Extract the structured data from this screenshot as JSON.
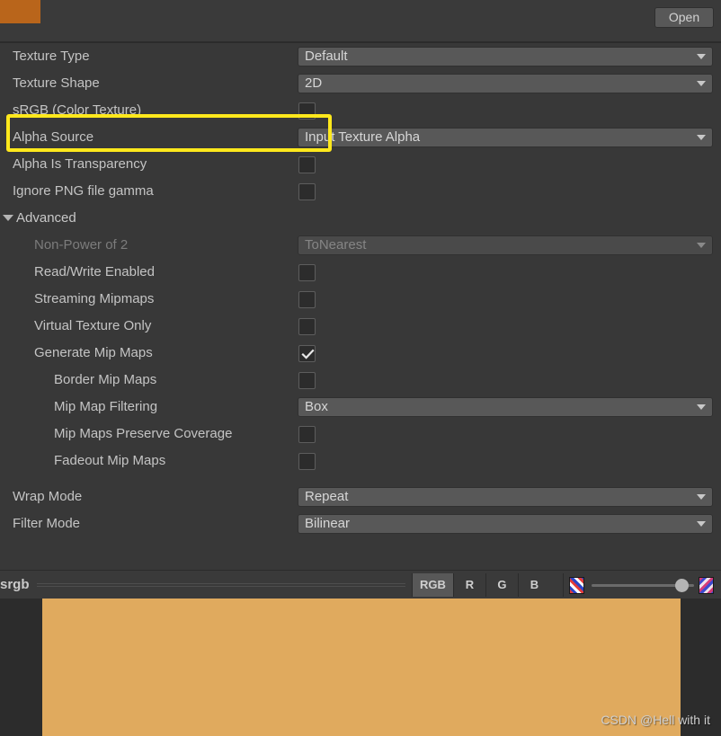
{
  "window": {
    "open_button": "Open",
    "tab_color": "#b9651b"
  },
  "inspector": {
    "rows": [
      {
        "label": "Texture Type",
        "control": "dropdown",
        "value": "Default",
        "indent": 0,
        "disabled": false
      },
      {
        "label": "Texture Shape",
        "control": "dropdown",
        "value": "2D",
        "indent": 0,
        "disabled": false
      },
      {
        "label": "sRGB (Color Texture)",
        "control": "checkbox",
        "checked": false,
        "indent": 0,
        "disabled": false,
        "highlighted": true
      },
      {
        "label": "Alpha Source",
        "control": "dropdown",
        "value": "Input Texture Alpha",
        "indent": 0,
        "disabled": false
      },
      {
        "label": "Alpha Is Transparency",
        "control": "checkbox",
        "checked": false,
        "indent": 0,
        "disabled": false
      },
      {
        "label": "Ignore PNG file gamma",
        "control": "checkbox",
        "checked": false,
        "indent": 0,
        "disabled": false
      }
    ],
    "advanced": {
      "label": "Advanced",
      "expanded": true,
      "rows": [
        {
          "label": "Non-Power of 2",
          "control": "dropdown",
          "value": "ToNearest",
          "indent": 1,
          "disabled": true
        },
        {
          "label": "Read/Write Enabled",
          "control": "checkbox",
          "checked": false,
          "indent": 1,
          "disabled": false
        },
        {
          "label": "Streaming Mipmaps",
          "control": "checkbox",
          "checked": false,
          "indent": 1,
          "disabled": false
        },
        {
          "label": "Virtual Texture Only",
          "control": "checkbox",
          "checked": false,
          "indent": 1,
          "disabled": false
        },
        {
          "label": "Generate Mip Maps",
          "control": "checkbox",
          "checked": true,
          "indent": 1,
          "disabled": false
        },
        {
          "label": "Border Mip Maps",
          "control": "checkbox",
          "checked": false,
          "indent": 2,
          "disabled": false
        },
        {
          "label": "Mip Map Filtering",
          "control": "dropdown",
          "value": "Box",
          "indent": 2,
          "disabled": false
        },
        {
          "label": "Mip Maps Preserve Coverage",
          "control": "checkbox",
          "checked": false,
          "indent": 2,
          "disabled": false
        },
        {
          "label": "Fadeout Mip Maps",
          "control": "checkbox",
          "checked": false,
          "indent": 2,
          "disabled": false
        }
      ]
    },
    "tail_rows": [
      {
        "label": "Wrap Mode",
        "control": "dropdown",
        "value": "Repeat",
        "indent": 0,
        "disabled": false
      },
      {
        "label": "Filter Mode",
        "control": "dropdown",
        "value": "Bilinear",
        "indent": 0,
        "disabled": false
      }
    ]
  },
  "preview": {
    "asset_name": "srgb",
    "channels": [
      {
        "label": "RGB",
        "active": true
      },
      {
        "label": "R",
        "active": false
      },
      {
        "label": "G",
        "active": false
      },
      {
        "label": "B",
        "active": false
      }
    ],
    "mip_level_percent": 84,
    "texture_color": "#e0aa5e",
    "watermark": "CSDN @Hell with it"
  },
  "highlight": {
    "color": "#ffe81c"
  }
}
